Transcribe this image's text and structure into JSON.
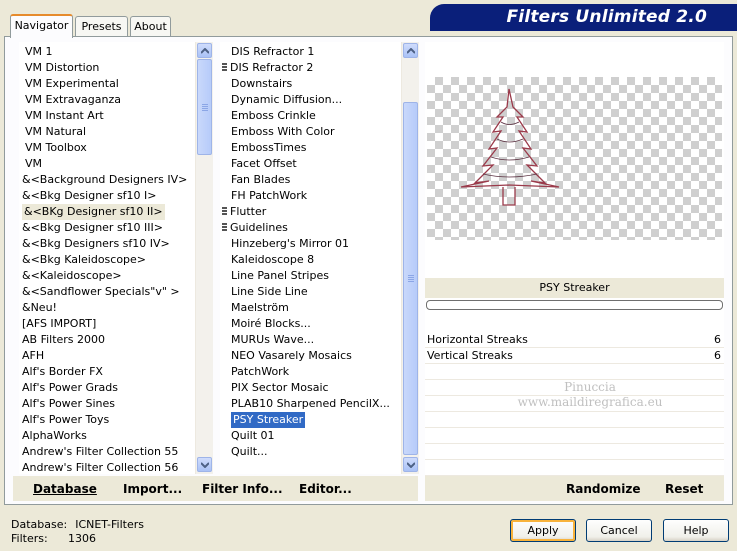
{
  "title": "Filters Unlimited 2.0",
  "tabs": [
    {
      "label": "Navigator"
    },
    {
      "label": "Presets"
    },
    {
      "label": "About"
    }
  ],
  "categories": [
    {
      "label": "VM 1"
    },
    {
      "label": "VM Distortion"
    },
    {
      "label": "VM Experimental"
    },
    {
      "label": "VM Extravaganza"
    },
    {
      "label": "VM Instant Art"
    },
    {
      "label": "VM Natural"
    },
    {
      "label": "VM Toolbox"
    },
    {
      "label": "VM"
    },
    {
      "label": "&<Background Designers IV>"
    },
    {
      "label": "&<Bkg Designer sf10 I>"
    },
    {
      "label": "&<BKg Designer sf10 II>"
    },
    {
      "label": "&<Bkg Designer sf10 III>"
    },
    {
      "label": "&<Bkg Designers sf10 IV>"
    },
    {
      "label": "&<Bkg Kaleidoscope>"
    },
    {
      "label": "&<Kaleidoscope>"
    },
    {
      "label": "&<Sandflower Specials\"v\" >"
    },
    {
      "label": "&Neu!"
    },
    {
      "label": "[AFS IMPORT]"
    },
    {
      "label": "AB Filters 2000"
    },
    {
      "label": "AFH"
    },
    {
      "label": "Alf's Border FX"
    },
    {
      "label": "Alf's Power Grads"
    },
    {
      "label": "Alf's Power Sines"
    },
    {
      "label": "Alf's Power Toys"
    },
    {
      "label": "AlphaWorks"
    },
    {
      "label": "Andrew's Filter Collection 55"
    },
    {
      "label": "Andrew's Filter Collection 56"
    }
  ],
  "selected_category": "&<BKg Designer sf10 II>",
  "filters": [
    {
      "label": "DIS Refractor 1",
      "grip": false
    },
    {
      "label": "DIS Refractor 2",
      "grip": true
    },
    {
      "label": "Downstairs",
      "grip": false
    },
    {
      "label": "Dynamic Diffusion...",
      "grip": false
    },
    {
      "label": "Emboss Crinkle",
      "grip": false
    },
    {
      "label": "Emboss With Color",
      "grip": false
    },
    {
      "label": "EmbossTimes",
      "grip": false
    },
    {
      "label": "Facet Offset",
      "grip": false
    },
    {
      "label": "Fan Blades",
      "grip": false
    },
    {
      "label": "FH PatchWork",
      "grip": false
    },
    {
      "label": "Flutter",
      "grip": true
    },
    {
      "label": "Guidelines",
      "grip": true
    },
    {
      "label": "Hinzeberg's Mirror 01",
      "grip": false
    },
    {
      "label": "Kaleidoscope 8",
      "grip": false
    },
    {
      "label": "Line Panel Stripes",
      "grip": false
    },
    {
      "label": "Line Side Line",
      "grip": false
    },
    {
      "label": "Maelström",
      "grip": false
    },
    {
      "label": "Moiré Blocks...",
      "grip": false
    },
    {
      "label": "MURUs Wave...",
      "grip": false
    },
    {
      "label": "NEO Vasarely Mosaics",
      "grip": false
    },
    {
      "label": "PatchWork",
      "grip": false
    },
    {
      "label": "PIX Sector Mosaic",
      "grip": false
    },
    {
      "label": "PLAB10 Sharpened PencilX...",
      "grip": false
    },
    {
      "label": "PSY Streaker",
      "grip": false
    },
    {
      "label": "Quilt 01",
      "grip": false
    },
    {
      "label": "Quilt...",
      "grip": false
    }
  ],
  "selected_filter": "PSY Streaker",
  "preview": {
    "filter_name": "PSY Streaker",
    "watermark_line1": "Pinuccia",
    "watermark_line2": "www.maildiregrafica.eu"
  },
  "parameters": [
    {
      "name": "Horizontal Streaks",
      "value": "6"
    },
    {
      "name": "Vertical Streaks",
      "value": "6"
    }
  ],
  "bottom_links": {
    "database": "Database",
    "import": "Import...",
    "filter_info": "Filter Info...",
    "editor": "Editor..."
  },
  "right_links": {
    "randomize": "Randomize",
    "reset": "Reset"
  },
  "status": {
    "database_label": "Database:",
    "database_value": "ICNET-Filters",
    "filters_label": "Filters:",
    "filters_value": "1306"
  },
  "buttons": {
    "apply": "Apply",
    "cancel": "Cancel",
    "help": "Help"
  },
  "colors": {
    "banner": "#0a1f7a",
    "selection": "#316ac5",
    "window_bg": "#ece9d8"
  }
}
